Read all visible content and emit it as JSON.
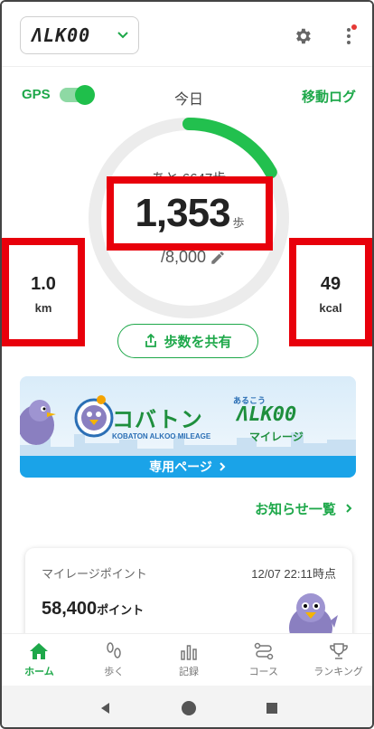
{
  "header": {
    "app_name": "ΛLK00",
    "icons": [
      "chevron-down-icon",
      "gear-icon",
      "more-vertical-icon"
    ]
  },
  "status": {
    "gps_label": "GPS",
    "gps_on": true,
    "date_label": "今日",
    "move_log_label": "移動ログ"
  },
  "steps": {
    "remaining_text": "あと 6647歩",
    "count": "1,353",
    "unit": "歩",
    "goal": "/8,000",
    "progress": 0.169
  },
  "distance": {
    "value": "1.0",
    "unit": "km"
  },
  "calories": {
    "value": "49",
    "unit": "kcal"
  },
  "share": {
    "label": "歩数を共有",
    "icon": "share-icon"
  },
  "banner": {
    "title": "コバトン",
    "kana": "あるこう",
    "logo": "ΛLK00",
    "subtitle": "KOBATON ALKOO MILEAGE",
    "mileage": "マイレージ",
    "link_label": "専用ページ"
  },
  "news": {
    "label": "お知らせ一覧"
  },
  "mileage_card": {
    "title": "マイレージポイント",
    "timestamp": "12/07 22:11時点",
    "points": "58,400",
    "points_unit": "ポイント"
  },
  "bottom_nav": [
    {
      "label": "ホーム",
      "icon": "home-icon",
      "active": true
    },
    {
      "label": "歩く",
      "icon": "footprints-icon",
      "active": false
    },
    {
      "label": "記録",
      "icon": "bar-chart-icon",
      "active": false
    },
    {
      "label": "コース",
      "icon": "route-icon",
      "active": false
    },
    {
      "label": "ランキング",
      "icon": "trophy-icon",
      "active": false
    }
  ],
  "colors": {
    "accent": "#1ea84a",
    "highlight": "#e8000b",
    "link_blue": "#1aa3e8"
  }
}
